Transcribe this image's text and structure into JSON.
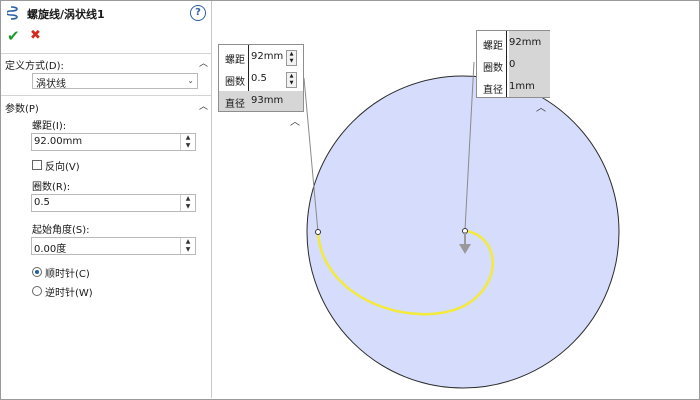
{
  "header": {
    "title": "螺旋线/涡状线1",
    "help_glyph": "?",
    "ok_glyph": "✔",
    "cancel_glyph": "✖"
  },
  "definition": {
    "section_label": "定义方式(D):",
    "selected": "涡状线"
  },
  "parameters": {
    "section_label": "参数(P)",
    "pitch_label": "螺距(I):",
    "pitch_value": "92.00mm",
    "reverse_label": "反向(V)",
    "reverse_checked": false,
    "revolutions_label": "圈数(R):",
    "revolutions_value": "0.5",
    "start_angle_label": "起始角度(S):",
    "start_angle_value": "0.00度",
    "clockwise_label": "顺时针(C)",
    "counterclockwise_label": "逆时针(W)",
    "direction_selected": "clockwise"
  },
  "callout_left": {
    "pitch_key": "螺距",
    "pitch_value": "92mm",
    "revs_key": "圈数",
    "revs_value": "0.5",
    "dia_key": "直径",
    "dia_value": "93mm"
  },
  "callout_right": {
    "pitch_key": "螺距",
    "pitch_value": "92mm",
    "revs_key": "圈数",
    "revs_value": "0",
    "dia_key": "直径",
    "dia_value": "1mm"
  },
  "colors": {
    "circle_fill": "#d6dcfb",
    "spiral": "#f3ea3a",
    "accept": "#1e9a2b",
    "cancel": "#d42a1f",
    "highlight": "#d6d6d6"
  }
}
